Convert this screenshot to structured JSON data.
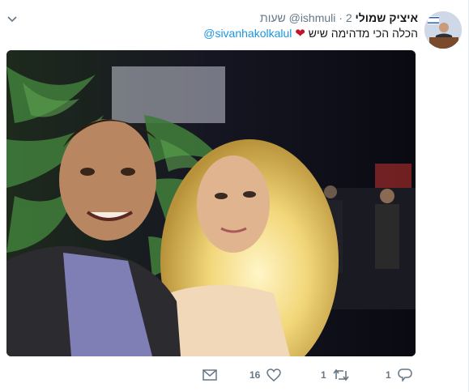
{
  "tweet": {
    "author_name": "איציק שמולי",
    "author_handle": "@ishmuli",
    "separator": "·",
    "time": "2 שעות",
    "text": "הכלה הכי מדהימה שיש",
    "heart_emoji": "❤",
    "mention": "@sivanhakolkalul"
  },
  "actions": {
    "reply_count": "1",
    "retweet_count": "1",
    "like_count": "16"
  },
  "icons": {
    "caret": "chevron-down-icon",
    "message": "envelope-icon",
    "like": "heart-outline-icon",
    "retweet": "retweet-icon",
    "reply": "speech-bubble-icon"
  },
  "colors": {
    "link": "#1b95e0",
    "secondary_text": "#657786",
    "heart": "#c3132b"
  }
}
